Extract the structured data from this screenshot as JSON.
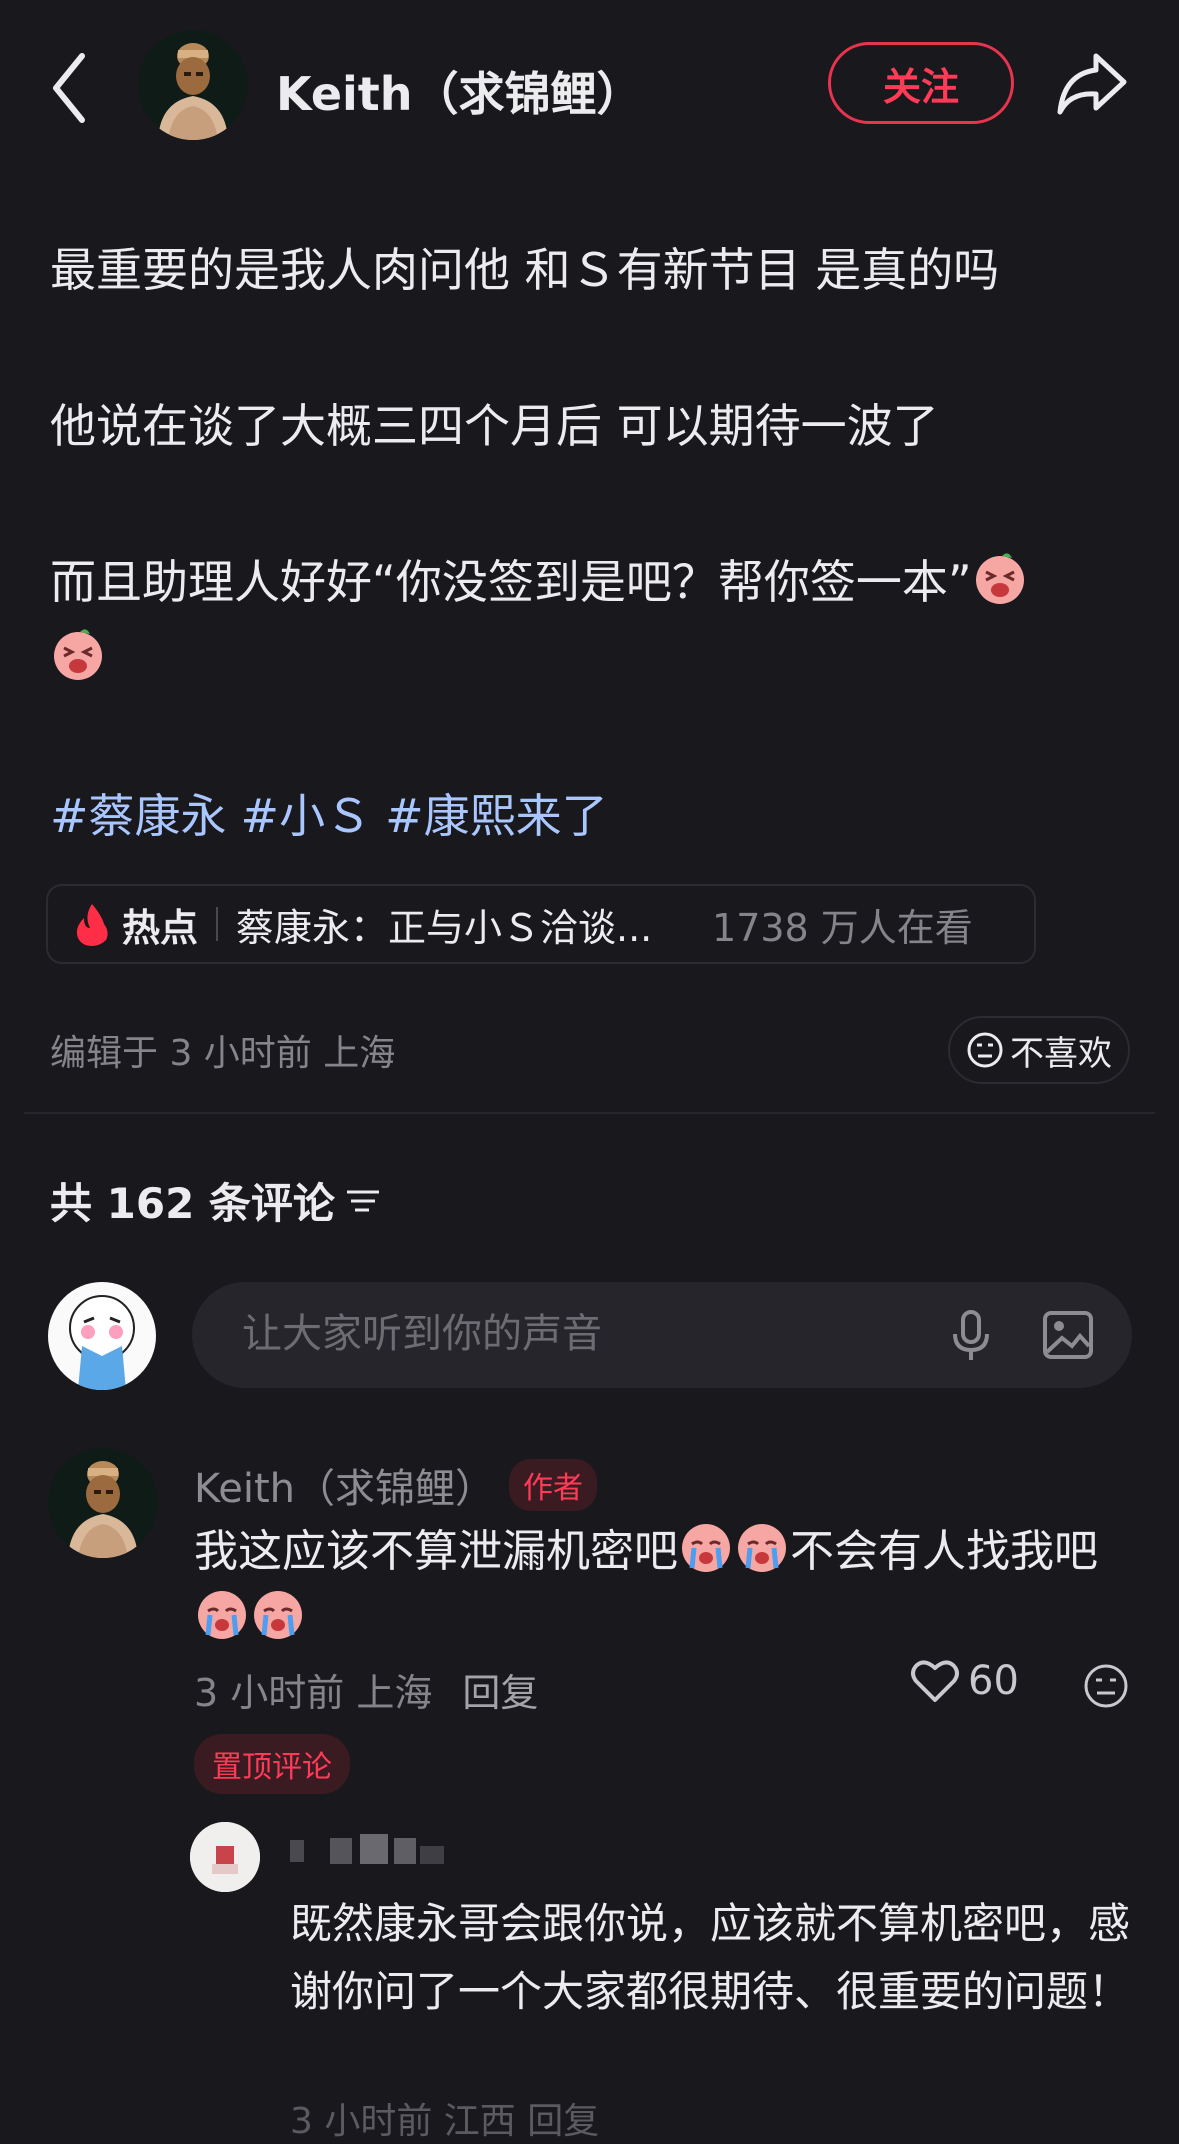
{
  "header": {
    "author_name": "Keith（求锦鲤）",
    "follow_label": "关注"
  },
  "post": {
    "paragraphs": [
      "最重要的是我人肉问他 和Ｓ有新节目 是真的吗",
      "他说在谈了大概三四个月后 可以期待一波了",
      "而且助理人好好“你没签到是吧？帮你签一本”"
    ],
    "tags": [
      "#蔡康永",
      "#小Ｓ",
      "#康熙来了"
    ],
    "hot": {
      "label": "热点",
      "title": "蔡康永：正与小Ｓ洽谈...",
      "count": "1738 万人在看"
    },
    "meta": "编辑于 3 小时前 上海",
    "dislike_label": "不喜欢"
  },
  "comments": {
    "header": "共 162 条评论",
    "input_placeholder": "让大家听到你的声音",
    "first": {
      "author": "Keith（求锦鲤）",
      "badge": "作者",
      "text_1": "我这应该不算泄漏机密吧",
      "text_2": "不会有人找我吧",
      "meta_time_location": "3 小时前 上海",
      "reply_label": "回复",
      "likes": "60",
      "pinned_label": "置顶评论"
    },
    "reply": {
      "text": "既然康永哥会跟你说，应该就不算机密吧，感谢你问了一个大家都很期待、很重要的问题！",
      "meta_visible": "3 小时前 江西 回复"
    }
  },
  "colors": {
    "background": "#19181d",
    "accent_red": "#ff3b57",
    "hashtag_blue": "#a9c6ff",
    "muted_text": "#85848b"
  },
  "icons": [
    "back-arrow-icon",
    "share-icon",
    "flame-icon",
    "neutral-face-icon",
    "filter-lines-icon",
    "microphone-icon",
    "image-icon",
    "heart-icon",
    "laughing-emoji-icon",
    "crying-emoji-icon"
  ]
}
